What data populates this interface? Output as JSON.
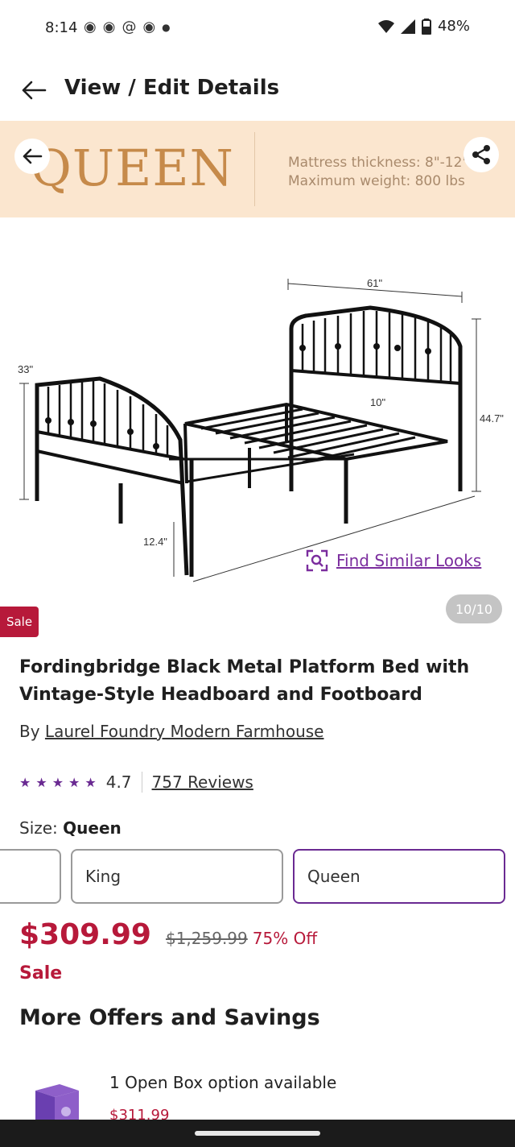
{
  "status_bar": {
    "time": "8:14",
    "notification_icons": [
      "snapchat-icon",
      "snapchat-icon",
      "threads-icon",
      "snapchat-icon",
      "dot-icon"
    ],
    "battery": "48%"
  },
  "header": {
    "title": "View / Edit Details"
  },
  "gallery": {
    "banner_size": "QUEEN",
    "banner_spec_1": "Mattress thickness:  8\"-12\"",
    "banner_spec_2": "Maximum weight:   800 lbs",
    "dimensions": {
      "width": "61\"",
      "height": "44.7\"",
      "foot_height": "33\"",
      "clearance": "10\"",
      "leg_height": "12.4\""
    },
    "find_similar": "Find Similar Looks",
    "counter": "10/10"
  },
  "product": {
    "badge": "Sale",
    "title": "Fordingbridge Black Metal Platform Bed with Vintage-Style Headboard and Footboard",
    "by_prefix": "By",
    "brand": "Laurel Foundry Modern Farmhouse",
    "stars": "★★★★★",
    "rating": "4.7",
    "reviews": "757 Reviews"
  },
  "size": {
    "label": "Size:",
    "selected": "Queen",
    "options": [
      "",
      "King",
      "Queen"
    ]
  },
  "pricing": {
    "price": "$309.99",
    "original_price": "$1,259.99",
    "discount": "75% Off",
    "sale_label": "Sale"
  },
  "offers": {
    "section_title": "More Offers and Savings",
    "open_box_text": "1 Open Box option available",
    "open_box_price": "$311.99"
  },
  "colors": {
    "accent_purple": "#6a2a92",
    "sale_red": "#b7193a",
    "banner_bg": "#fbe6cf",
    "banner_text": "#c68a4a"
  }
}
